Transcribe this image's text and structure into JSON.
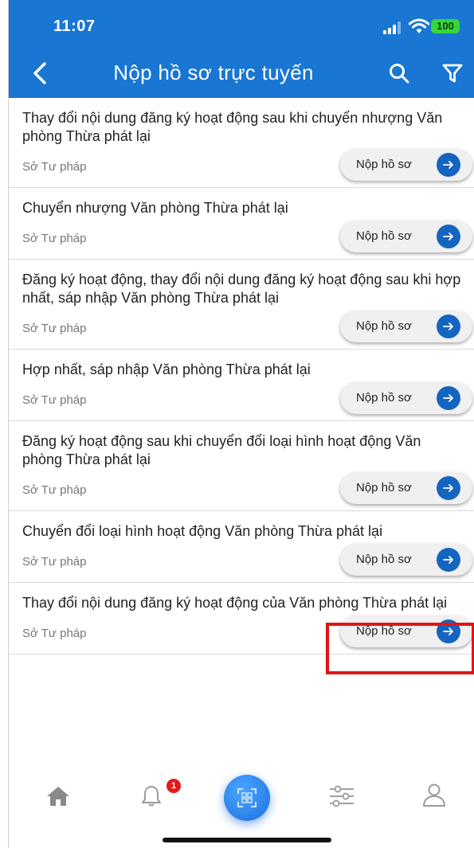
{
  "status_bar": {
    "time": "11:07",
    "battery": "100"
  },
  "nav": {
    "title": "Nộp hồ sơ trực tuyến"
  },
  "colors": {
    "primary": "#1976d2",
    "accent": "#1565c0",
    "badge": "#e31b1b",
    "highlight": "#e01515"
  },
  "procedures": [
    {
      "title": "Thay đổi nội dung đăng ký hoạt động sau khi chuyển nhượng Văn phòng Thừa phát lại",
      "agency": "Sở Tư pháp",
      "action": "Nộp hồ sơ"
    },
    {
      "title": "Chuyển nhượng Văn phòng Thừa phát lại",
      "agency": "Sở Tư pháp",
      "action": "Nộp hồ sơ"
    },
    {
      "title": "Đăng ký hoạt động, thay đổi nội dung đăng ký hoạt động sau khi hợp nhất, sáp nhập Văn phòng Thừa phát lại",
      "agency": "Sở Tư pháp",
      "action": "Nộp hồ sơ"
    },
    {
      "title": "Hợp nhất, sáp nhập Văn phòng Thừa phát lại",
      "agency": "Sở Tư pháp",
      "action": "Nộp hồ sơ"
    },
    {
      "title": "Đăng ký hoạt động sau khi chuyển đổi loại hình hoạt động Văn phòng Thừa phát lại",
      "agency": "Sở Tư pháp",
      "action": "Nộp hồ sơ"
    },
    {
      "title": "Chuyển đổi loại hình hoạt động Văn phòng Thừa phát lại",
      "agency": "Sở Tư pháp",
      "action": "Nộp hồ sơ"
    },
    {
      "title": "Thay đổi nội dung đăng ký hoạt động của Văn phòng Thừa phát lại",
      "agency": "Sở Tư pháp",
      "action": "Nộp hồ sơ"
    }
  ],
  "bottom_nav": {
    "items": [
      "home-icon",
      "bell-icon",
      "qr-scan-icon",
      "sliders-icon",
      "user-icon"
    ],
    "notification_count": "1"
  }
}
